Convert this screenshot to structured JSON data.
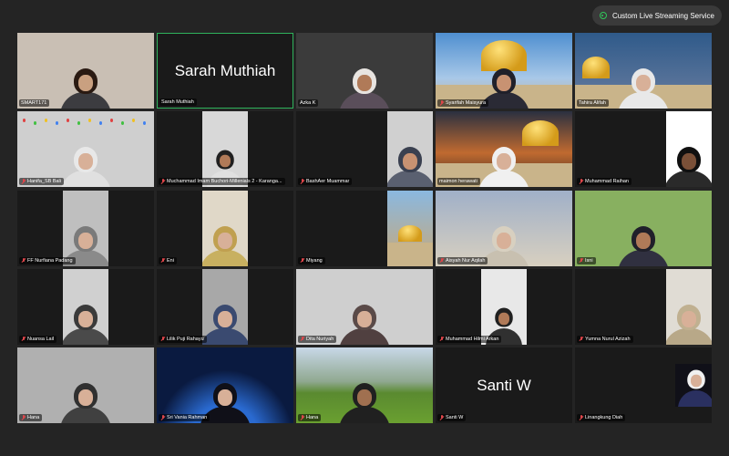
{
  "banner": {
    "label": "Custom Live Streaming Service",
    "icon": "live-broadcast-icon",
    "accent": "#31c65a"
  },
  "active_speaker_color": "#2fb35c",
  "muted_color": "#e0464b",
  "tiles": [
    {
      "name": "SMART171",
      "big": "",
      "muted": false,
      "bg": "#c9bfb4",
      "video": "full",
      "scene": "person",
      "skin": "#c9a080",
      "hair": "#2a1a12",
      "shirt": "#3c3c40"
    },
    {
      "name": "Sarah Muthiah",
      "big": "Sarah Muthiah",
      "muted": false,
      "active": true
    },
    {
      "name": "Azka K",
      "big": "",
      "muted": false,
      "bg": "#3b3b3b",
      "video": "full",
      "scene": "person",
      "skin": "#b07a58",
      "hair": "#e8e4e0",
      "shirt": "#5a4e5a"
    },
    {
      "name": "Syarifah Maisyura",
      "big": "",
      "muted": true,
      "bg": "#6aa0d8",
      "video": "full",
      "scene": "dome",
      "skin": "#c89272",
      "hair": "#20202a",
      "shirt": "#2a2a35"
    },
    {
      "name": "Tahira Alifah",
      "big": "",
      "muted": false,
      "bg": "#2f5a8a",
      "video": "full",
      "scene": "dome-person",
      "skin": "#d8b098",
      "hair": "#e8e8e8",
      "shirt": "#e8e8e8"
    },
    {
      "name": "Hanifa_SB Bali",
      "big": "",
      "muted": true,
      "bg": "#cfcfcf",
      "video": "full",
      "scene": "person-lights",
      "skin": "#d8b098",
      "hair": "#e8e8e8",
      "shirt": "#e0e0e0"
    },
    {
      "name": "Muchammad Imam Buchori-Millenials 2 - Karanga...",
      "big": "",
      "muted": true,
      "bg": "#d8d8d8",
      "video": "center",
      "scene": "person-small",
      "skin": "#b07a58",
      "hair": "#202020",
      "shirt": "#e0e0e0"
    },
    {
      "name": "BashAer Muammar",
      "big": "",
      "muted": true,
      "bg": "#d0d0d0",
      "video": "right",
      "scene": "person",
      "skin": "#c89272",
      "hair": "#3a4050",
      "shirt": "#5a6070"
    },
    {
      "name": "maimon herawati",
      "big": "",
      "muted": false,
      "bg": "#3a3020",
      "video": "full",
      "scene": "sunset-dome",
      "skin": "#d8b098",
      "hair": "#f0f0f0",
      "shirt": "#f0f0f0"
    },
    {
      "name": "Muhammad Raihan",
      "big": "",
      "muted": true,
      "bg": "#ffffff",
      "video": "right",
      "scene": "person",
      "skin": "#7a5038",
      "hair": "#101010",
      "shirt": "#2a2a2a"
    },
    {
      "name": "FF Nurfiana Padang",
      "big": "",
      "muted": true,
      "bg": "#bfbfbf",
      "video": "center",
      "scene": "person",
      "skin": "#d8b098",
      "hair": "#7a7a7a",
      "shirt": "#8a8a8a"
    },
    {
      "name": "Eni",
      "big": "",
      "muted": true,
      "bg": "#e0d8c8",
      "video": "center",
      "scene": "person",
      "skin": "#d8b098",
      "hair": "#c0a050",
      "shirt": "#c8b060"
    },
    {
      "name": "Miyang",
      "big": "",
      "muted": true,
      "bg": "#7aa6cc",
      "video": "right",
      "scene": "arch-dome",
      "skin": "",
      "hair": "",
      "shirt": ""
    },
    {
      "name": "Aisyah Nur Aqilah",
      "big": "",
      "muted": true,
      "bg": "#b8c0c8",
      "video": "full",
      "scene": "city-person",
      "skin": "#d8b098",
      "hair": "#d8d0c0",
      "shirt": "#c8c0b0"
    },
    {
      "name": "Isni",
      "big": "",
      "muted": true,
      "bg": "#88b060",
      "video": "full",
      "scene": "person",
      "skin": "#b07a58",
      "hair": "#20202a",
      "shirt": "#303040"
    },
    {
      "name": "Nuansa Lail",
      "big": "",
      "muted": true,
      "bg": "#d0d0d0",
      "video": "center",
      "scene": "person",
      "skin": "#d8b098",
      "hair": "#3a3a3a",
      "shirt": "#4a4a4a"
    },
    {
      "name": "Lilik Puji Rahayu",
      "big": "",
      "muted": true,
      "bg": "#a8a8a8",
      "video": "center",
      "scene": "person",
      "skin": "#d8b098",
      "hair": "#3a4a70",
      "shirt": "#3a4a70"
    },
    {
      "name": "Dita Nuriyah",
      "big": "",
      "muted": true,
      "bg": "#cfcfcf",
      "video": "full",
      "scene": "person",
      "skin": "#d8b098",
      "hair": "#5a4a48",
      "shirt": "#504040"
    },
    {
      "name": "Muhammad Hilmi Arkan",
      "big": "",
      "muted": true,
      "bg": "#e8e8e8",
      "video": "center",
      "scene": "person-small",
      "skin": "#b07a58",
      "hair": "#202020",
      "shirt": "#303030"
    },
    {
      "name": "Yumna Nurul Azizah",
      "big": "",
      "muted": true,
      "bg": "#e0dcd4",
      "video": "right",
      "scene": "person",
      "skin": "#d8b098",
      "hair": "#c0b090",
      "shirt": "#b8a888"
    },
    {
      "name": "Hana",
      "big": "",
      "muted": true,
      "bg": "#b0b0b0",
      "video": "full",
      "scene": "person",
      "skin": "#d8b098",
      "hair": "#303030",
      "shirt": "#404040"
    },
    {
      "name": "Sri Vania Rahman",
      "big": "",
      "muted": true,
      "bg": "#0a1a40",
      "video": "full",
      "scene": "earth-person",
      "skin": "#d8b098",
      "hair": "#101018",
      "shirt": "#101018"
    },
    {
      "name": "Hana",
      "big": "",
      "muted": true,
      "bg": "#5a7a40",
      "video": "full",
      "scene": "park",
      "skin": "#a07050",
      "hair": "#202020",
      "shirt": "#202020"
    },
    {
      "name": "Santi W",
      "big": "Santi W",
      "muted": true
    },
    {
      "name": "Linangkung Diah",
      "big": "",
      "muted": true,
      "bg": "#101018",
      "video": "tiny",
      "scene": "person-night",
      "skin": "#d8b098",
      "hair": "#f0f0f0",
      "shirt": "#2a3060"
    }
  ]
}
